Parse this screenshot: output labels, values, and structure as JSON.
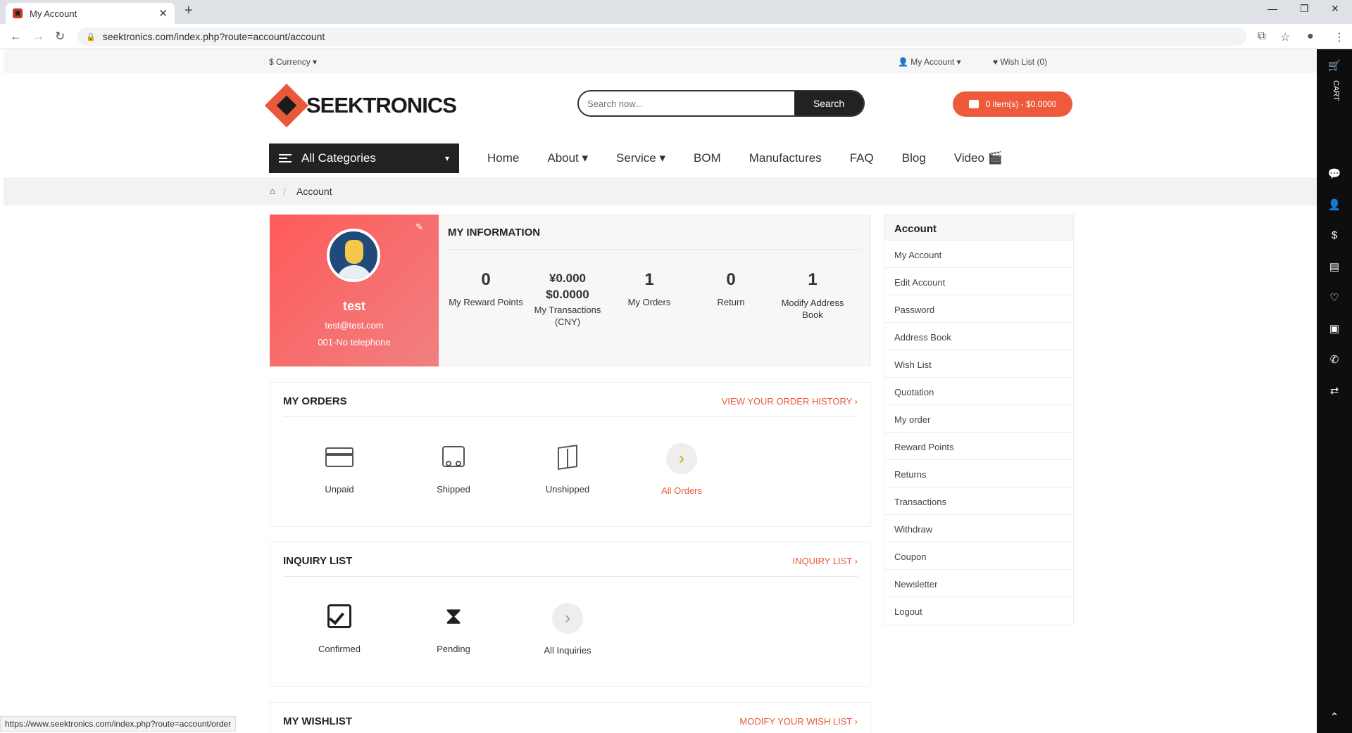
{
  "browser": {
    "tab_title": "My Account",
    "url": "seektronics.com/index.php?route=account/account",
    "status_url": "https://www.seektronics.com/index.php?route=account/order"
  },
  "topbar": {
    "currency": "$ Currency ▾",
    "my_account": "👤 My Account ▾",
    "wishlist": "♥ Wish List (0)"
  },
  "header": {
    "logo_text": "SEEKTRONICS",
    "search_placeholder": "Search now...",
    "search_button": "Search",
    "cart": "0 item(s) - $0.0000"
  },
  "menu": {
    "all_categories": "All Categories",
    "items": [
      "Home",
      "About ▾",
      "Service ▾",
      "BOM",
      "Manufactures",
      "FAQ",
      "Blog",
      "Video 🎬"
    ]
  },
  "breadcrumb": {
    "current": "Account"
  },
  "profile": {
    "name": "test",
    "email": "test@test.com",
    "phone": "001-No telephone"
  },
  "my_information": {
    "title": "MY INFORMATION",
    "stats": [
      {
        "value": "0",
        "label": "My Reward Points"
      },
      {
        "value": "¥0.000",
        "value2": "$0.0000",
        "label": "My Transactions (CNY)"
      },
      {
        "value": "1",
        "label": "My Orders"
      },
      {
        "value": "0",
        "label": "Return"
      },
      {
        "value": "1",
        "label": "Modify Address Book"
      }
    ]
  },
  "orders": {
    "title": "MY ORDERS",
    "link": "VIEW YOUR ORDER HISTORY ›",
    "items": [
      "Unpaid",
      "Shipped",
      "Unshipped",
      "All Orders"
    ]
  },
  "inquiry": {
    "title": "INQUIRY LIST",
    "link": "INQUIRY LIST ›",
    "items": [
      "Confirmed",
      "Pending",
      "All Inquiries"
    ]
  },
  "wishlist": {
    "title": "MY WISHLIST",
    "link": "MODIFY YOUR WISH LIST ›"
  },
  "sidebar": {
    "title": "Account",
    "items": [
      "My Account",
      "Edit Account",
      "Password",
      "Address Book",
      "Wish List",
      "Quotation",
      "My order",
      "Reward Points",
      "Returns",
      "Transactions",
      "Withdraw",
      "Coupon",
      "Newsletter",
      "Logout"
    ]
  },
  "rail": {
    "cart_label": "CART"
  }
}
